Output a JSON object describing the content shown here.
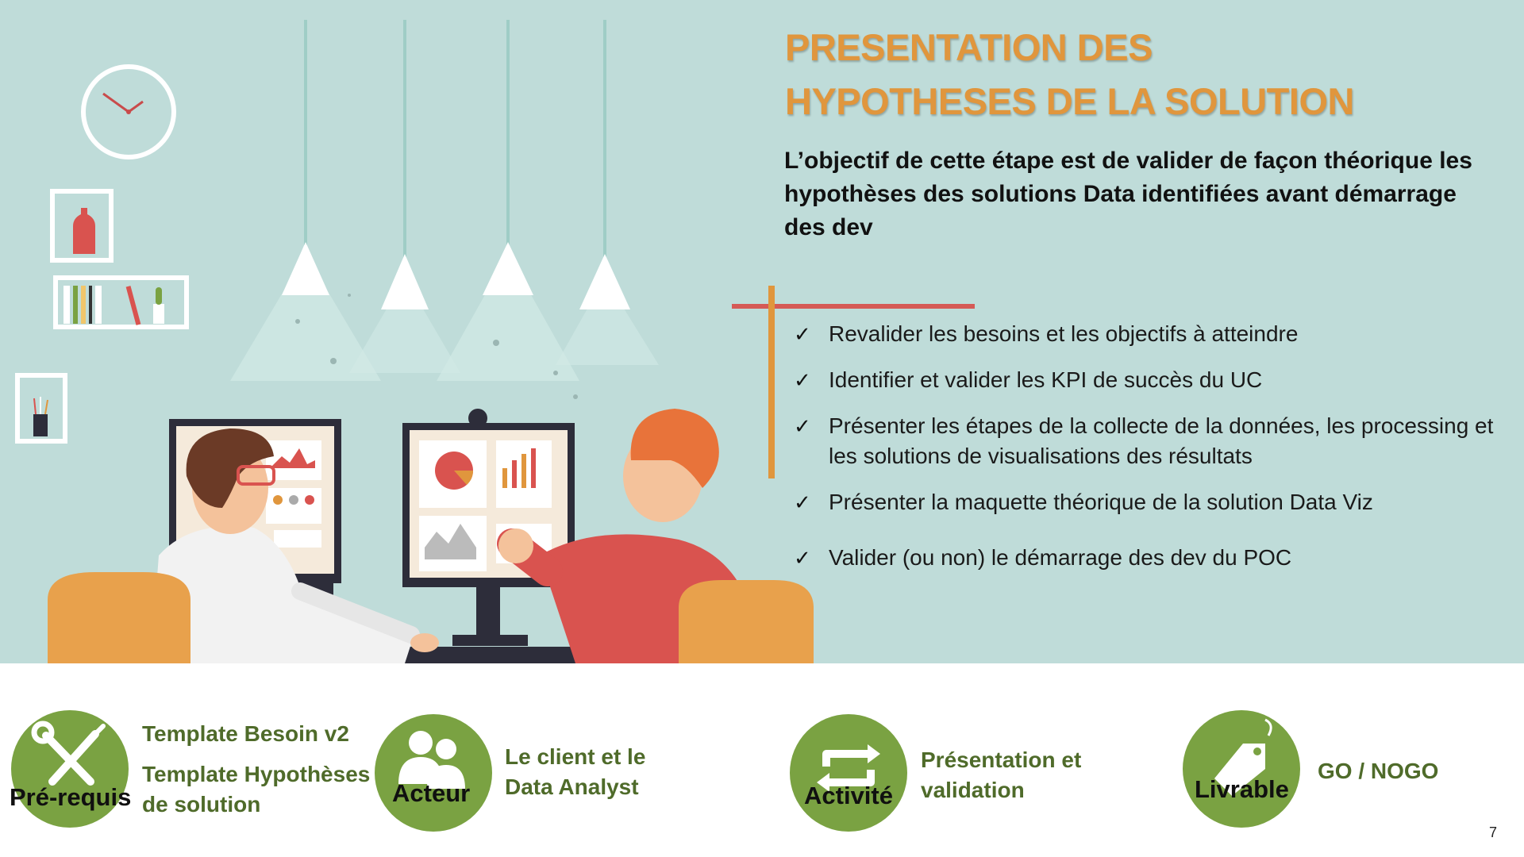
{
  "slide": {
    "title_lines": [
      "PRESENTATION DES",
      "HYPOTHESES DE LA SOLUTION"
    ],
    "objective": "L’objectif de cette étape est de valider de façon théorique les hypothèses des solutions Data identifiées avant démarrage des dev",
    "bullets": [
      "Revalider les besoins et les objectifs à atteindre",
      "Identifier et valider les KPI de succès du UC",
      "Présenter les étapes de la collecte de la données, les processing et les solutions de visualisations des résultats",
      "Présenter la maquette théorique de la solution Data Viz",
      "Valider (ou non) le démarrage des dev du POC"
    ],
    "check_glyph": "✓",
    "page_number": "7"
  },
  "badges": {
    "prerequis": {
      "label": "Pré-requis",
      "icon": "tools-icon",
      "texts": [
        "Template Besoin v2",
        "Template Hypothèses de solution"
      ]
    },
    "acteur": {
      "label": "Acteur",
      "icon": "users-icon",
      "text": "Le client et le Data Analyst"
    },
    "activite": {
      "label": "Activité",
      "icon": "repeat-icon",
      "text": "Présentation et validation"
    },
    "livrable": {
      "label": "Livrable",
      "icon": "tag-icon",
      "text": "GO / NOGO"
    }
  },
  "colors": {
    "background": "#bfdcd9",
    "title": "#e0963d",
    "badge": "#7aa242",
    "badge_text": "#4f6b2a",
    "accent_red": "#d55a56",
    "accent_orange": "#e0963d"
  }
}
